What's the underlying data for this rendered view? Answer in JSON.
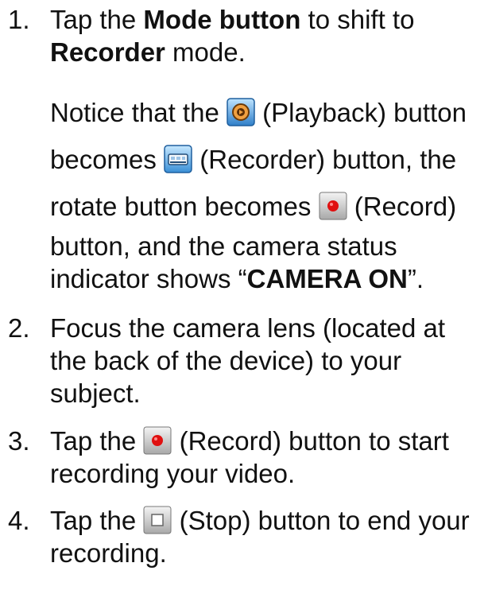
{
  "steps": [
    {
      "number": "1.",
      "line1_a": "Tap the ",
      "line1_b": "Mode button",
      "line1_c": " to shift to",
      "line2_a": "Recorder",
      "line2_b": " mode."
    },
    {
      "note_l1_a": "Notice that the ",
      "note_l1_b": " (Playback) button",
      "note_l2_a": "becomes ",
      "note_l2_b": " (Recorder) button, the",
      "note_l3_a": "rotate button becomes ",
      "note_l3_b": " (Record)",
      "note_l4": "button, and the camera status",
      "note_l5_a": "indicator shows “",
      "note_l5_b": "CAMERA ON",
      "note_l5_c": "”."
    },
    {
      "number": "2.",
      "line1": "Focus the camera lens (located at",
      "line2": "the back of the device) to your",
      "line3": "subject."
    },
    {
      "number": "3.",
      "line1_a": "Tap the ",
      "line1_b": " (Record) button to start",
      "line2": "recording your video."
    },
    {
      "number": "4.",
      "line1_a": "Tap the ",
      "line1_b": " (Stop) button to end your",
      "line2": "recording."
    }
  ],
  "icons": {
    "playback": "playback-icon",
    "recorder": "recorder-icon",
    "record": "record-icon",
    "stop": "stop-icon"
  },
  "colors": {
    "text": "#111111",
    "record_red": "#e01010",
    "icon_frame_blue": "#3a8fd6",
    "playback_orange": "#e8902a"
  }
}
